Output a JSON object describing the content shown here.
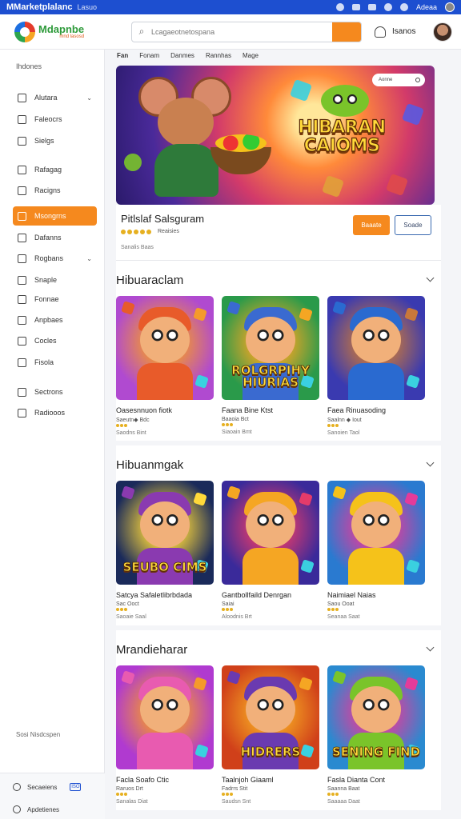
{
  "system_bar": {
    "app_name": "MMarketplalanc",
    "subtitle": "Lasuo",
    "right_label": "Adeaa"
  },
  "header": {
    "logo_title": "Mdapnbe",
    "logo_sub": "mnd lasosd",
    "search_placeholder": "Lcagaeotnetospana",
    "user_label": "Isanos"
  },
  "sidebar": {
    "heading": "Ihdones",
    "items": [
      {
        "label": "Alutara",
        "icon": "home-icon",
        "chevron": "⌄"
      },
      {
        "label": "Faleocrs",
        "icon": "document-icon",
        "chevron": ""
      },
      {
        "label": "Sielgs",
        "icon": "grid-icon",
        "chevron": ""
      },
      {
        "label": "Rafagag",
        "icon": "document-icon",
        "chevron": ""
      },
      {
        "label": "Racigns",
        "icon": "calendar-icon",
        "chevron": ""
      },
      {
        "label": "Msongrns",
        "icon": "image-icon",
        "chevron": "",
        "active": true
      },
      {
        "label": "Dafanns",
        "icon": "document-icon",
        "chevron": ""
      },
      {
        "label": "Rogbans",
        "icon": "clock-icon",
        "chevron": "⌄"
      },
      {
        "label": "Snaple",
        "icon": "bag-icon",
        "chevron": ""
      },
      {
        "label": "Fonnae",
        "icon": "chart-icon",
        "chevron": ""
      },
      {
        "label": "Anpbaes",
        "icon": "tag-icon",
        "chevron": ""
      },
      {
        "label": "Cocles",
        "icon": "document-icon",
        "chevron": ""
      },
      {
        "label": "Fisola",
        "icon": "edit-icon",
        "chevron": ""
      },
      {
        "label": "Sectrons",
        "icon": "gear-icon",
        "chevron": ""
      },
      {
        "label": "Radiooos",
        "icon": "document-icon",
        "chevron": ""
      }
    ],
    "footer_text": "Sosi Nisdcspen",
    "bottom_items": [
      {
        "label": "Secaeiens",
        "badge": "ISO"
      },
      {
        "label": "Apdetienes",
        "badge": ""
      }
    ]
  },
  "tabs": [
    "Fan",
    "Fonam",
    "Danmes",
    "Rannhas",
    "Mage"
  ],
  "hero": {
    "title_line1": "HIBARAN",
    "title_line2": "CAIOMS",
    "chip": "Aonne"
  },
  "featured": {
    "name": "Pitlslaf Salsguram",
    "rating_text": "Reaisies",
    "meta": "Sanalis Baas",
    "primary_button": "Baaate",
    "secondary_button": "Soade"
  },
  "sections": [
    {
      "title": "Hibuaraclam",
      "cards": [
        {
          "name": "Oasesnnuon fiotk",
          "sub": "Saeutn◆ Bdc",
          "downloads": "Saodns Bint",
          "thumb_title": "",
          "palette": [
            "#b04ad0",
            "#f59a2a",
            "#e85b2a"
          ]
        },
        {
          "name": "Faana Bine Ktst",
          "sub": "Baaoia Bct",
          "downloads": "Siaoain Bmt",
          "thumb_title": "ROLGRPIHY HIURIAS",
          "palette": [
            "#2a9a4a",
            "#f5a623",
            "#3a6ad0"
          ]
        },
        {
          "name": "Faea Rinuasoding",
          "sub": "Saalnn ◆ Iout",
          "downloads": "Sanoien Taol",
          "thumb_title": "",
          "palette": [
            "#3a3ab0",
            "#c9783a",
            "#2a6ad0"
          ]
        }
      ]
    },
    {
      "title": "Hibuanmgak",
      "cards": [
        {
          "name": "Satcya Safaletlibrbdada",
          "sub": "Sac Ooct",
          "downloads": "Saoaie Saal",
          "thumb_title": "SEUBO CIMS",
          "palette": [
            "#1a2a5a",
            "#ffd93a",
            "#8a3ab0"
          ]
        },
        {
          "name": "Gantbollfaild Denrgan",
          "sub": "Saiai",
          "downloads": "Aloodnis Brt",
          "thumb_title": "",
          "palette": [
            "#3a2a9a",
            "#e43b6a",
            "#f5a623"
          ]
        },
        {
          "name": "Naimiael Naias",
          "sub": "Saou Ooat",
          "downloads": "Seanaa Saat",
          "thumb_title": "",
          "palette": [
            "#2a7ad0",
            "#e43b9a",
            "#f5c21a"
          ]
        }
      ]
    },
    {
      "title": "Mrandieharar",
      "cards": [
        {
          "name": "Facla Soafo Ctic",
          "sub": "Raruos Drt",
          "downloads": "Sanalas Diat",
          "thumb_title": "",
          "palette": [
            "#b03ad0",
            "#f59a2a",
            "#e85bb0"
          ]
        },
        {
          "name": "Taalnjoh Giaaml",
          "sub": "Fadrrs Stit",
          "downloads": "Saudsn Snt",
          "thumb_title": "HIDRERS",
          "palette": [
            "#d0401a",
            "#f5a623",
            "#6a3ab0"
          ]
        },
        {
          "name": "Fasla Dianta Cont",
          "sub": "Saanna Baat",
          "downloads": "Saaaaa Daat",
          "thumb_title": "SENING FIND",
          "palette": [
            "#2a8ad0",
            "#e43b9a",
            "#7ac42a"
          ]
        }
      ]
    }
  ]
}
